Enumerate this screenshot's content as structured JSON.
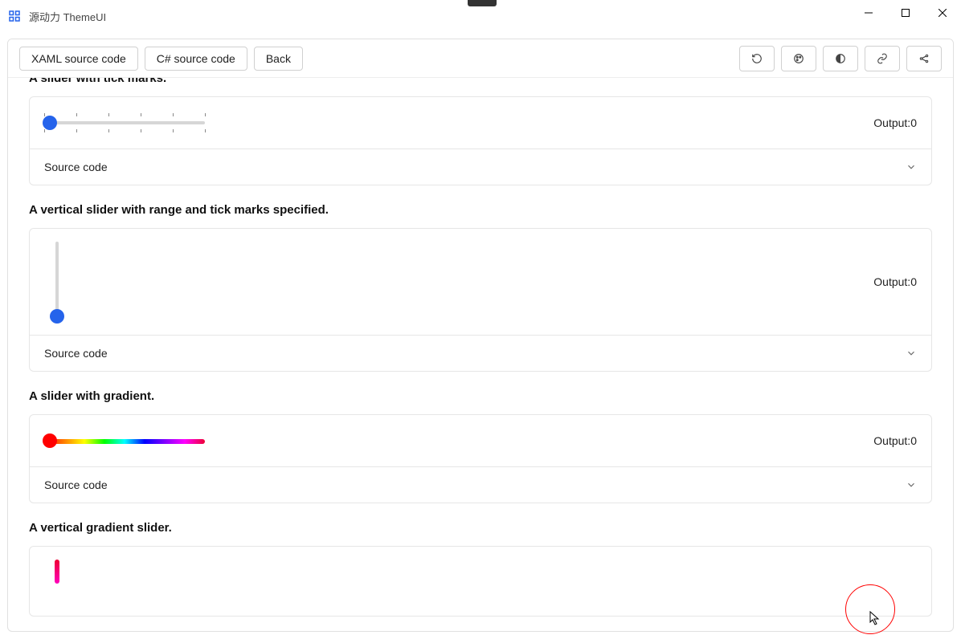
{
  "window": {
    "title": "源动力 ThemeUI"
  },
  "toolbar": {
    "xaml_label": "XAML source code",
    "csharp_label": "C# source code",
    "back_label": "Back"
  },
  "sections": {
    "s1": {
      "title": "A slider with tick marks.",
      "output_label": "Output:",
      "output_value": "0",
      "source_label": "Source code"
    },
    "s2": {
      "title": "A vertical slider with range and tick marks specified.",
      "output_label": "Output:",
      "output_value": "0",
      "source_label": "Source code"
    },
    "s3": {
      "title": "A slider with gradient.",
      "output_label": "Output:",
      "output_value": "0",
      "source_label": "Source code"
    },
    "s4": {
      "title": "A vertical gradient slider."
    }
  },
  "colors": {
    "accent": "#2563eb",
    "border": "#e6e6e6"
  }
}
